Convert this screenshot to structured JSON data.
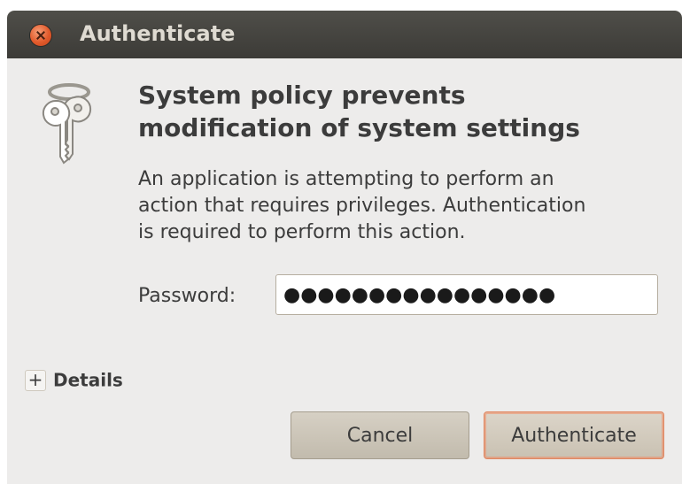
{
  "window": {
    "title": "Authenticate"
  },
  "dialog": {
    "icon": "keys-icon",
    "heading_line1": "System policy prevents",
    "heading_line2": "modification of system settings",
    "body_line1": "An application is attempting to perform an",
    "body_line2": "action that requires privileges. Authentication",
    "body_line3": "is required to perform this action.",
    "password_label": "Password:",
    "password_value": "●●●●●●●●●●●●●●●●",
    "details_toggle": "+",
    "details_label": "Details"
  },
  "buttons": {
    "cancel": "Cancel",
    "authenticate": "Authenticate"
  },
  "colors": {
    "titlebar": "#3c3b37",
    "close_button": "#e25a2b",
    "window_bg": "#edeceb",
    "default_button_focus": "#e0855f"
  }
}
